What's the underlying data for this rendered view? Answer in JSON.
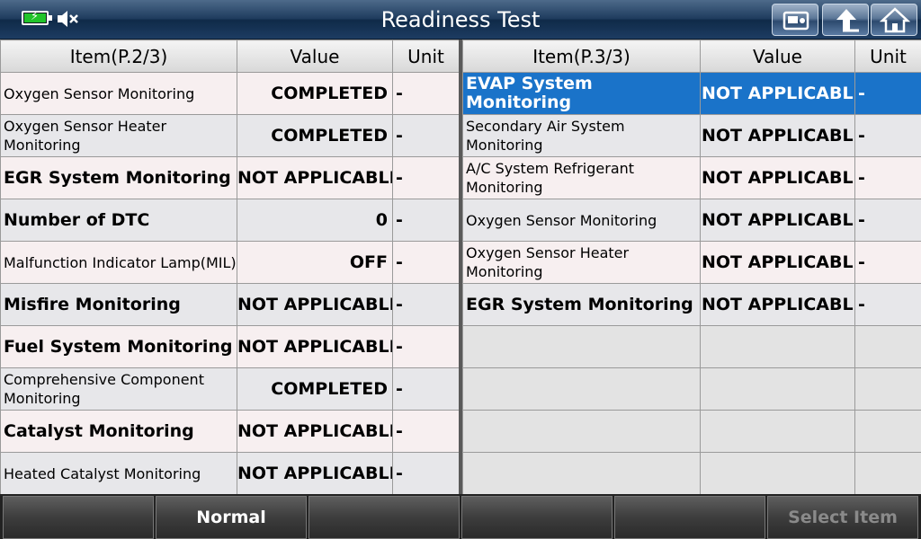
{
  "header": {
    "title": "Readiness Test"
  },
  "left": {
    "columns": [
      "Item(P.2/3)",
      "Value",
      "Unit"
    ],
    "rows": [
      {
        "item": "Oxygen Sensor Monitoring",
        "value": "COMPLETED",
        "unit": "-"
      },
      {
        "item": "Oxygen Sensor Heater Monitoring",
        "value": "COMPLETED",
        "unit": "-"
      },
      {
        "item": "EGR System Monitoring",
        "value": "NOT APPLICABLE",
        "unit": "-"
      },
      {
        "item": "Number of DTC",
        "value": "0",
        "unit": "-"
      },
      {
        "item": "Malfunction Indicator Lamp(MIL)",
        "value": "OFF",
        "unit": "-"
      },
      {
        "item": "Misfire Monitoring",
        "value": "NOT APPLICABLE",
        "unit": "-"
      },
      {
        "item": "Fuel System Monitoring",
        "value": "NOT APPLICABLE",
        "unit": "-"
      },
      {
        "item": "Comprehensive Component Monitoring",
        "value": "COMPLETED",
        "unit": "-"
      },
      {
        "item": "Catalyst Monitoring",
        "value": "NOT APPLICABLE",
        "unit": "-"
      },
      {
        "item": "Heated Catalyst Monitoring",
        "value": "NOT APPLICABLE",
        "unit": "-"
      }
    ]
  },
  "right": {
    "columns": [
      "Item(P.3/3)",
      "Value",
      "Unit"
    ],
    "rows": [
      {
        "item": "EVAP System Monitoring",
        "value": "NOT APPLICABLE",
        "unit": "-"
      },
      {
        "item": "Secondary Air System Monitoring",
        "value": "NOT APPLICABLE",
        "unit": "-"
      },
      {
        "item": "A/C System Refrigerant Monitoring",
        "value": "NOT APPLICABLE",
        "unit": "-"
      },
      {
        "item": "Oxygen Sensor Monitoring",
        "value": "NOT APPLICABLE",
        "unit": "-"
      },
      {
        "item": "Oxygen Sensor Heater Monitoring",
        "value": "NOT APPLICABLE",
        "unit": "-"
      },
      {
        "item": "EGR System Monitoring",
        "value": "NOT APPLICABLE",
        "unit": "-"
      }
    ]
  },
  "bottom": {
    "buttons": [
      "",
      "Normal",
      "",
      "",
      "",
      "Select Item"
    ]
  },
  "colors": {
    "selected_row": "#1a73c9",
    "battery": "#21c42a"
  },
  "icons": [
    "battery-charging-icon",
    "speaker-mute-icon",
    "screenshot-icon",
    "back-arrow-icon",
    "home-icon"
  ]
}
